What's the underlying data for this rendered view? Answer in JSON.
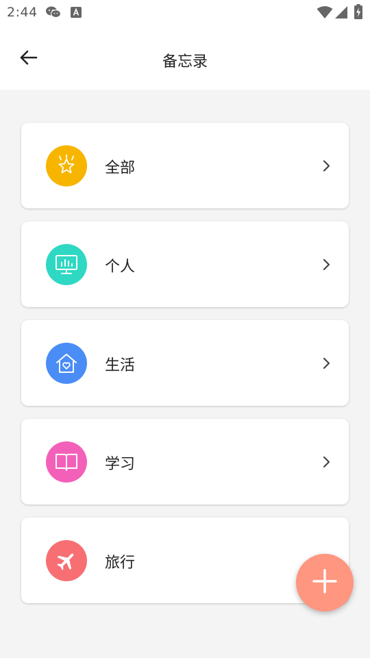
{
  "status_bar": {
    "time": "2:44"
  },
  "app_bar": {
    "title": "备忘录"
  },
  "categories": [
    {
      "label": "全部",
      "icon": "star-badge-icon",
      "color": "#F7B500",
      "has_chevron": true
    },
    {
      "label": "个人",
      "icon": "monitor-icon",
      "color": "#2ED8C3",
      "has_chevron": true
    },
    {
      "label": "生活",
      "icon": "home-heart-icon",
      "color": "#4A8DF6",
      "has_chevron": true
    },
    {
      "label": "学习",
      "icon": "book-icon",
      "color": "#F360BA",
      "has_chevron": true
    },
    {
      "label": "旅行",
      "icon": "airplane-icon",
      "color": "#F76F73",
      "has_chevron": false
    }
  ],
  "fab": {
    "icon": "plus-icon",
    "color": "#FF9680"
  }
}
